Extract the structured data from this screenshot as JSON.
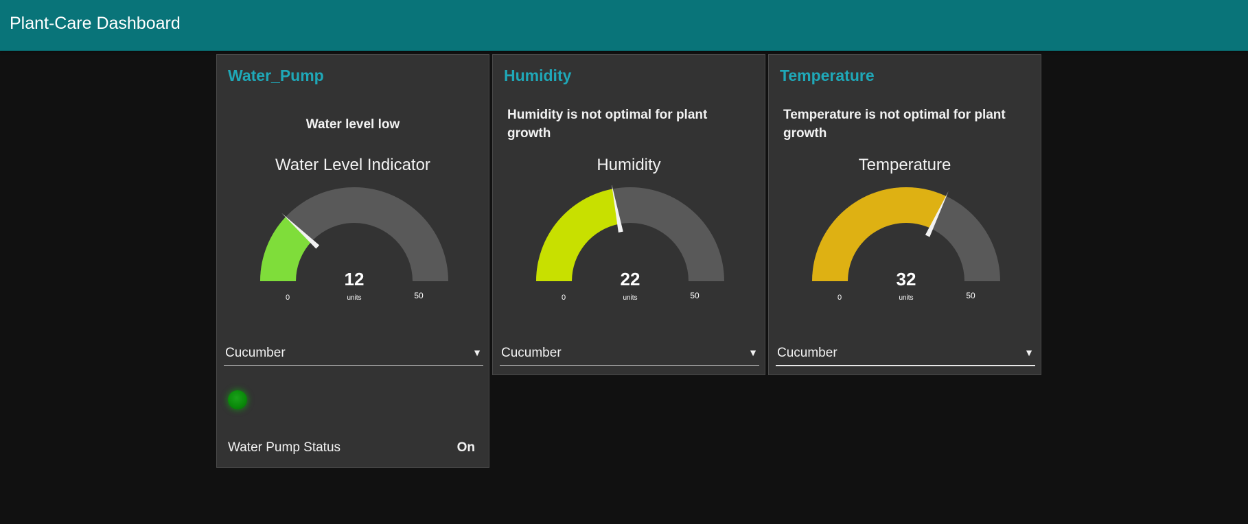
{
  "app": {
    "title": "Plant-Care Dashboard"
  },
  "cards": [
    {
      "title": "Water_Pump",
      "message": "Water level low",
      "gauge": {
        "title": "Water Level Indicator",
        "value": 12,
        "units": "units",
        "min": 0,
        "max": 50,
        "color": "#7fdd3a"
      },
      "dropdown": {
        "selected": "Cucumber"
      },
      "status": {
        "label": "Water Pump Status",
        "value": "On",
        "led_color": "#0a8a0a"
      }
    },
    {
      "title": "Humidity",
      "message": "Humidity is not optimal for plant growth",
      "gauge": {
        "title": "Humidity",
        "value": 22,
        "units": "units",
        "min": 0,
        "max": 50,
        "color": "#c8e000"
      },
      "dropdown": {
        "selected": "Cucumber"
      }
    },
    {
      "title": "Temperature",
      "message": "Temperature is not optimal for plant growth",
      "gauge": {
        "title": "Temperature",
        "value": 32,
        "units": "units",
        "min": 0,
        "max": 50,
        "color": "#deb113"
      },
      "dropdown": {
        "selected": "Cucumber"
      }
    }
  ],
  "colors": {
    "header": "#097479",
    "card": "#333333",
    "background": "#111111",
    "accent": "#1fa8b8",
    "gauge_track": "#595959"
  }
}
